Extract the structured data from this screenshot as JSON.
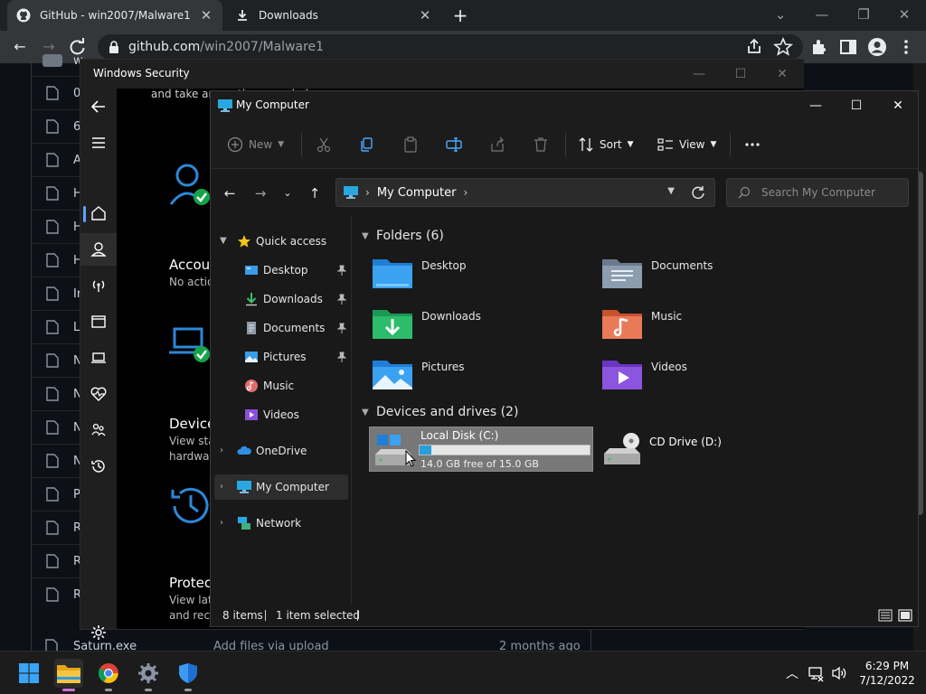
{
  "browser": {
    "tabs": [
      {
        "title": "GitHub - win2007/Malware1",
        "icon": "github-icon",
        "active": true
      },
      {
        "title": "Downloads",
        "icon": "download-icon",
        "active": false
      }
    ],
    "url_host": "github.com",
    "url_path": "/win2007/Malware1"
  },
  "github": {
    "file_letters": [
      "0",
      "6",
      "A",
      "H",
      "H",
      "H",
      "Ir",
      "L",
      "N",
      "N",
      "N",
      "N",
      "P",
      "R",
      "R",
      "R"
    ],
    "partial_top": "w",
    "bottom_row": {
      "name": "Saturn.exe",
      "commit": "Add files via upload",
      "age": "2 months ago"
    }
  },
  "windows_security": {
    "title": "Windows Security",
    "top_text": "and take any actions needed",
    "sections": [
      {
        "heading": "Accou",
        "sub1": "No actio",
        "sub2": ""
      },
      {
        "heading": "Device",
        "sub1": "View sta",
        "sub2": "hardwa"
      },
      {
        "heading": "Protect",
        "sub1": "View lat",
        "sub2": "and rec"
      }
    ]
  },
  "explorer": {
    "title": "My Computer",
    "commands": {
      "new": "New",
      "sort": "Sort",
      "view": "View"
    },
    "address": {
      "crumb": "My Computer"
    },
    "search_placeholder": "Search My Computer",
    "sidebar": {
      "quick_access": "Quick access",
      "items": [
        {
          "label": "Desktop",
          "pinned": true
        },
        {
          "label": "Downloads",
          "pinned": true
        },
        {
          "label": "Documents",
          "pinned": true
        },
        {
          "label": "Pictures",
          "pinned": true
        },
        {
          "label": "Music",
          "pinned": false
        },
        {
          "label": "Videos",
          "pinned": false
        }
      ],
      "onedrive": "OneDrive",
      "my_computer": "My Computer",
      "network": "Network"
    },
    "folders_header": "Folders (6)",
    "folders": [
      "Desktop",
      "Documents",
      "Downloads",
      "Music",
      "Pictures",
      "Videos"
    ],
    "drives_header": "Devices and drives (2)",
    "drives": [
      {
        "name": "Local Disk (C:)",
        "free_text": "14.0 GB free of 15.0 GB",
        "used_fraction": 0.067,
        "selected": true
      },
      {
        "name": "CD Drive (D:)"
      }
    ],
    "status": {
      "items": "8 items",
      "selected": "1 item selected"
    }
  },
  "taskbar": {
    "time": "6:29 PM",
    "date": "7/12/2022"
  },
  "colors": {
    "accent": "#26a0da",
    "folder": "#2f9be8",
    "selection": "#777777"
  }
}
